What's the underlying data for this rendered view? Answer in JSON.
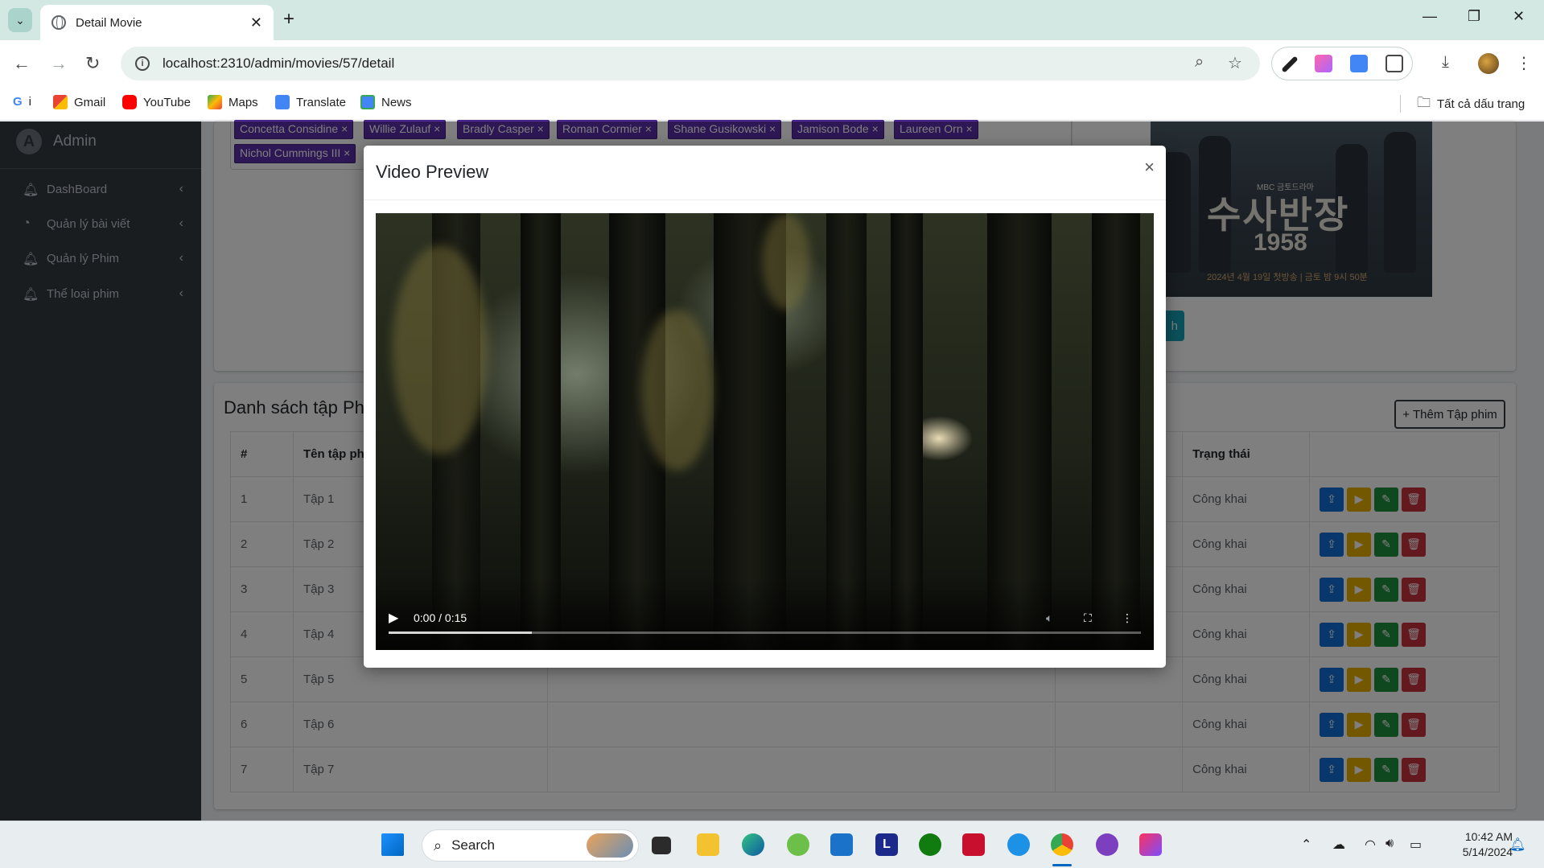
{
  "browser": {
    "tab_title": "Detail Movie",
    "url": "localhost:2310/admin/movies/57/detail",
    "bookmarks": [
      "Gmail",
      "YouTube",
      "Maps",
      "Translate",
      "News"
    ],
    "bookmark_first": "i",
    "all_bookmarks": "Tất cả dấu trang"
  },
  "sidebar": {
    "brand": "Admin",
    "items": [
      {
        "label": "DashBoard"
      },
      {
        "label": "Quản lý bài viết"
      },
      {
        "label": "Quản lý Phim"
      },
      {
        "label": "Thể loại phim"
      }
    ]
  },
  "actors": [
    "Concetta Considine",
    "Willie Zulauf",
    "Bradly Casper",
    "Roman Cormier",
    "Shane Gusikowski",
    "Jamison Bode",
    "Laureen Orn",
    "Nichol Cummings III"
  ],
  "poster": {
    "badge": "MBC 금토드라마",
    "title": "수사반장",
    "year": "1958",
    "line": "2024년 4월 19일 첫방송 | 금토 밤 9시 50분"
  },
  "episodes_card": {
    "title": "Danh sách tập Ph",
    "add_button": "Thêm Tập phim",
    "columns": [
      "#",
      "Tên tập ph",
      "",
      "",
      "Trạng thái",
      ""
    ],
    "rows": [
      {
        "num": "1",
        "name": "Tập 1",
        "status": "Công khai"
      },
      {
        "num": "2",
        "name": "Tập 2",
        "status": "Công khai"
      },
      {
        "num": "3",
        "name": "Tập 3",
        "status": "Công khai"
      },
      {
        "num": "4",
        "name": "Tập 4",
        "status": "Công khai"
      },
      {
        "num": "5",
        "name": "Tập 5",
        "status": "Công khai"
      },
      {
        "num": "6",
        "name": "Tập 6",
        "status": "Công khai"
      },
      {
        "num": "7",
        "name": "Tập 7",
        "status": "Công khai"
      }
    ],
    "teal_button_char": "h"
  },
  "modal": {
    "title": "Video Preview",
    "close": "×",
    "video": {
      "time": "0:00 / 0:15",
      "buffered_fraction": 0.19
    }
  },
  "taskbar": {
    "search_label": "Search",
    "time": "10:42 AM",
    "date": "5/14/2024"
  },
  "colors": {
    "sidebar_bg": "#343a40",
    "tag_bg": "#5b2fa8",
    "upload": "#0f6fd6",
    "play": "#e8b100",
    "edit": "#1e8e3e",
    "delete": "#c8323e"
  }
}
